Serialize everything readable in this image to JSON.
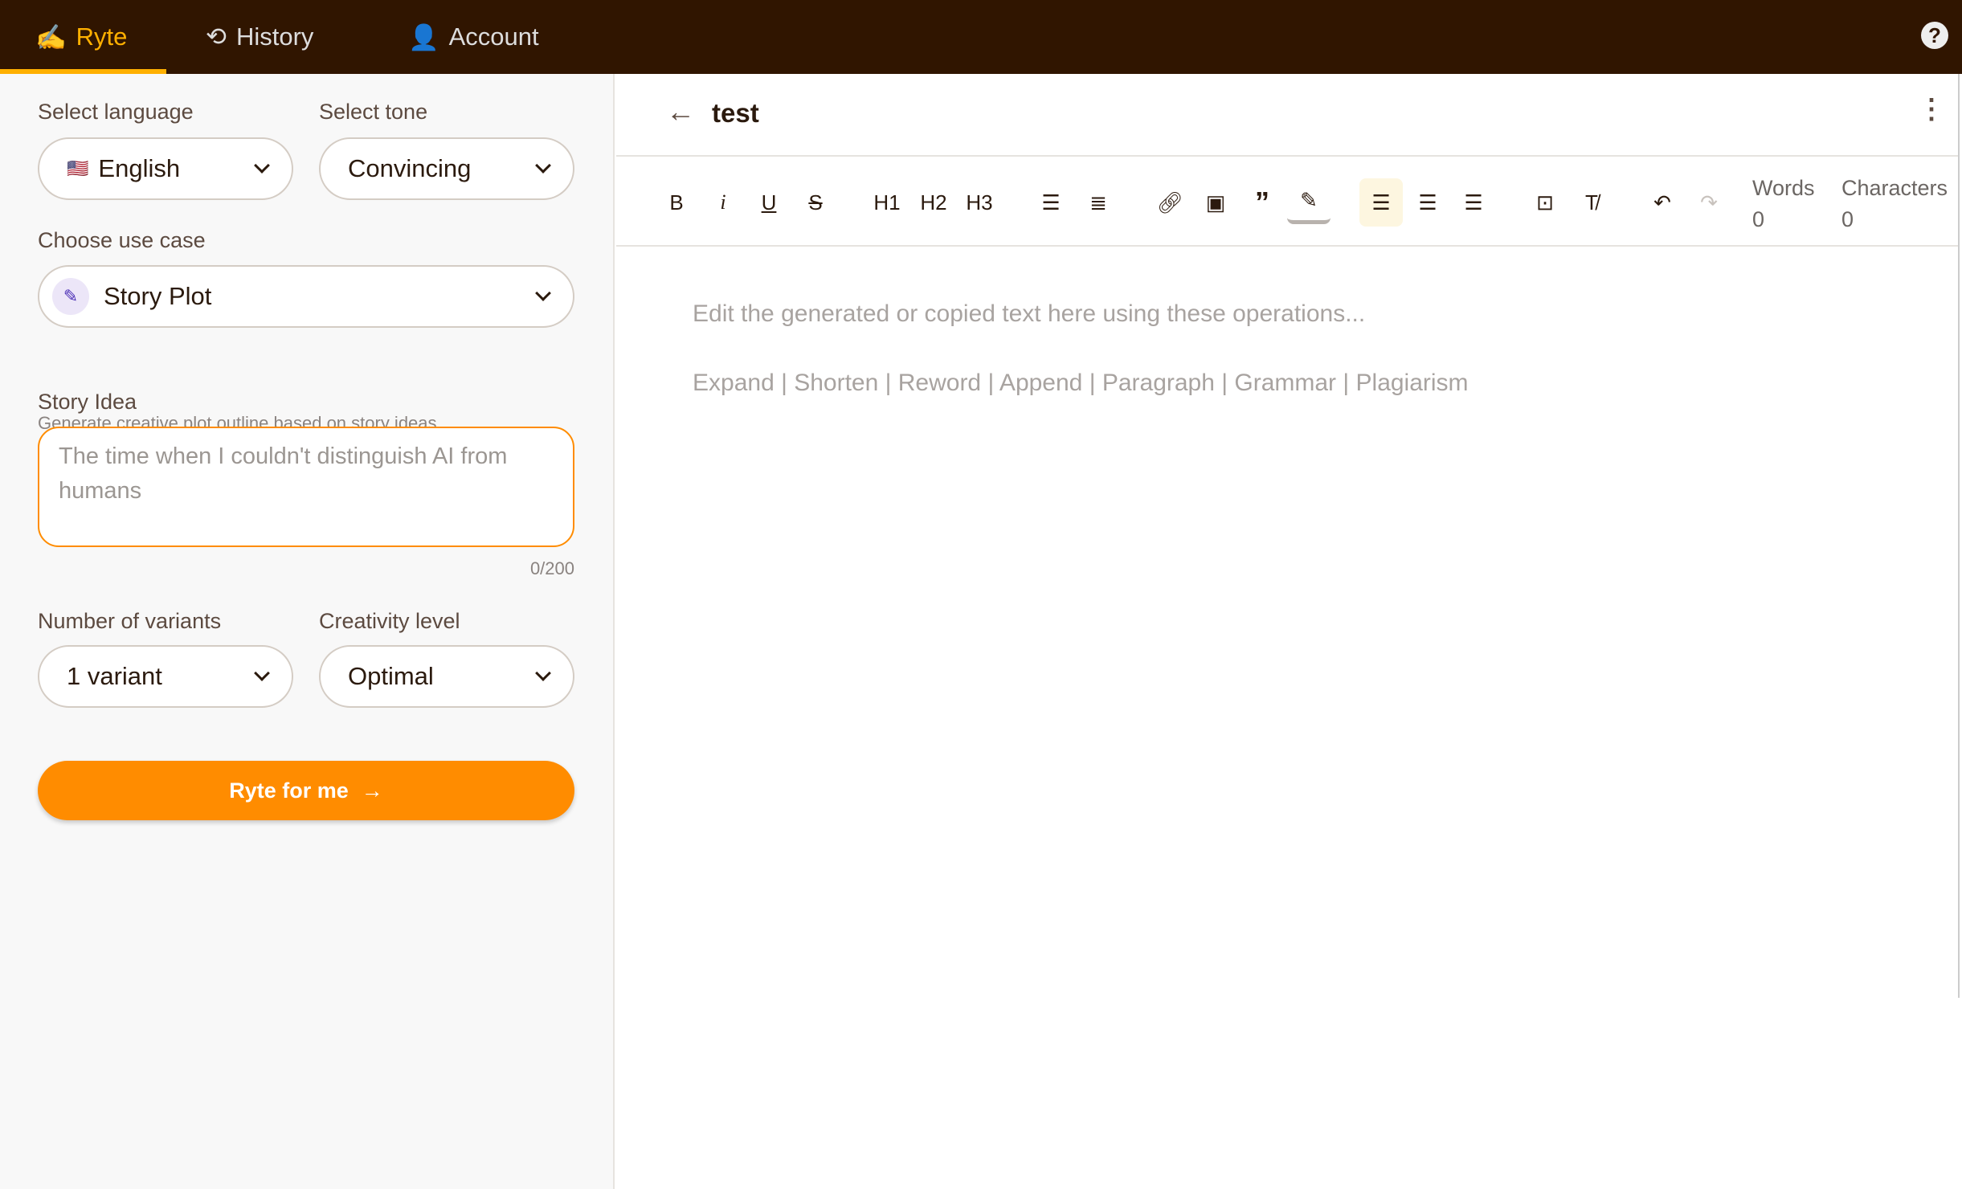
{
  "nav": {
    "tabs": [
      {
        "label": "Ryte",
        "icon": "writing-hand-icon",
        "active": true
      },
      {
        "label": "History",
        "icon": "history-icon"
      },
      {
        "label": "Account",
        "icon": "user-icon"
      }
    ],
    "help_icon": "?"
  },
  "form": {
    "language": {
      "label": "Select language",
      "value": "English",
      "flag": "🇺🇸"
    },
    "tone": {
      "label": "Select tone",
      "value": "Convincing"
    },
    "use_case": {
      "label": "Choose use case",
      "value": "Story Plot",
      "description": "Generate creative plot outline based on story ideas"
    },
    "story_idea": {
      "label": "Story Idea",
      "placeholder": "The time when I couldn't distinguish AI from humans",
      "value": "",
      "counter": "0/200"
    },
    "variants": {
      "label": "Number of variants",
      "value": "1 variant"
    },
    "creativity": {
      "label": "Creativity level",
      "value": "Optimal"
    },
    "submit_label": "Ryte for me"
  },
  "editor": {
    "title": "test",
    "toolbar": {
      "bold": "B",
      "italic": "i",
      "underline": "U",
      "strike": "S",
      "h1": "H1",
      "h2": "H2",
      "h3": "H3"
    },
    "words_label": "Words",
    "words": "0",
    "chars_label": "Characters",
    "chars": "0",
    "placeholder_line1": "Edit the generated or copied text here using these operations...",
    "placeholder_line2": "Expand | Shorten | Reword | Append | Paragraph | Grammar | Plagiarism"
  },
  "colors": {
    "topbar": "#301500",
    "accent": "#ffb000",
    "button": "#ff8c00"
  }
}
